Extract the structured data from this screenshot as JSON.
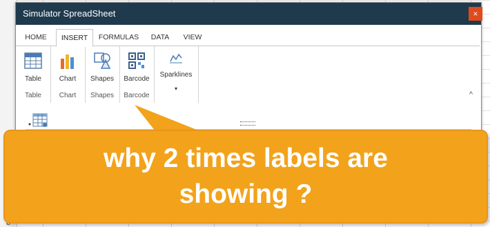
{
  "window": {
    "title": "Simulator SpreadSheet",
    "close_label": "×"
  },
  "tabs": [
    {
      "label": "HOME"
    },
    {
      "label": "INSERT"
    },
    {
      "label": "FORMULAS"
    },
    {
      "label": "DATA"
    },
    {
      "label": "VIEW"
    }
  ],
  "active_tab": "INSERT",
  "ribbon": {
    "groups": [
      {
        "command": "Table",
        "group_label": "Table",
        "icon": "table-icon"
      },
      {
        "command": "Chart",
        "group_label": "Chart",
        "icon": "chart-icon"
      },
      {
        "command": "Shapes",
        "group_label": "Shapes",
        "icon": "shapes-icon"
      },
      {
        "command": "Barcode",
        "group_label": "Barcode",
        "icon": "barcode-icon"
      },
      {
        "command": "Sparklines",
        "group_label": "",
        "icon": "sparkline-icon",
        "dropdown": "▾"
      }
    ],
    "collapse_icon": "^"
  },
  "grid": {
    "visible_row_number": "8"
  },
  "callout": {
    "line1": "why 2 times labels are",
    "line2": "showing ?",
    "color": "#f2a31b"
  },
  "colors": {
    "titlebar": "#1f3a4d",
    "close": "#e04a1c"
  }
}
